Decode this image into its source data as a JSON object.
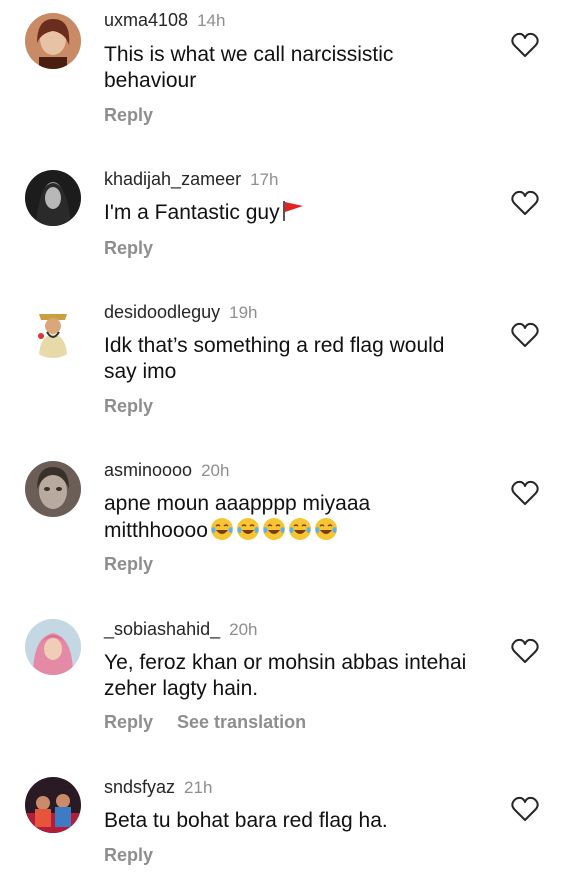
{
  "comments": [
    {
      "username": "uxma4108",
      "time": "14h",
      "line1": "This is what we call narcissistic",
      "line2": "behaviour",
      "reply": "Reply",
      "avatar": "woman-portrait"
    },
    {
      "username": "khadijah_zameer",
      "time": "17h",
      "line1": "I'm a Fantastic guy",
      "reply": "Reply",
      "avatar": "dark-portrait",
      "emoji": "red-flag-emoji"
    },
    {
      "username": "desidoodleguy",
      "time": "19h",
      "line1": "Idk that’s something a red flag would",
      "line2": "say imo",
      "reply": "Reply",
      "avatar": "cartoon-king"
    },
    {
      "username": "asminoooo",
      "time": "20h",
      "line1": "apne moun aaapppp miyaaa",
      "line2": "mitthhoooo",
      "reply": "Reply",
      "avatar": "sketch-portrait",
      "emoji": "tears-of-joy-emoji x5"
    },
    {
      "username": "_sobiashahid_",
      "time": "20h",
      "line1": "Ye, feroz khan or mohsin abbas intehai",
      "line2": "zeher lagty hain.",
      "reply": "Reply",
      "see_translation": "See translation",
      "avatar": "pink-scarf-portrait"
    },
    {
      "username": "sndsfyaz",
      "time": "21h",
      "line1": "Beta tu bohat bara red flag ha.",
      "reply": "Reply",
      "avatar": "stage-photo"
    }
  ],
  "colors": {
    "username": "#262626",
    "secondary": "#8e8e8e",
    "text": "#111111",
    "flag": "#e02424",
    "emoji": "#f7c531"
  },
  "icons": {
    "like": "heart-outline-icon"
  }
}
